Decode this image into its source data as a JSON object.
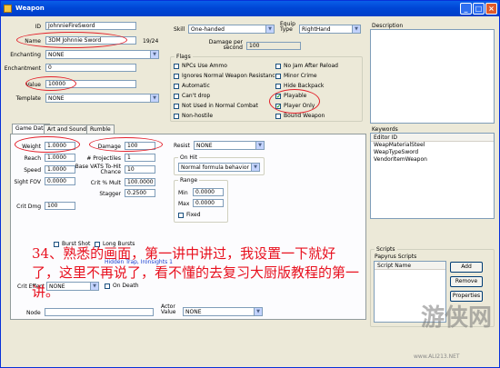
{
  "window": {
    "title": "Weapon",
    "min": "_",
    "max": "□",
    "close": "×"
  },
  "form": {
    "id_label": "ID",
    "id_value": "JohnnieFireSword",
    "name_label": "Name",
    "name_value": "3DM Johnnie Sword",
    "name_count": "19/24",
    "enchanting_label": "Enchanting",
    "enchanting_value": "NONE",
    "enchantment_label": "Enchantment",
    "enchantment_value": "0",
    "value_label": "Value",
    "value_value": "10000",
    "template_label": "Template",
    "template_value": "NONE",
    "skill_label": "Skill",
    "skill_value": "One-handed",
    "equip_label": "Equip Type",
    "equip_value": "RightHand",
    "damage_per_second_label": "Damage per second",
    "damage_per_second_value": "100"
  },
  "flags": {
    "title": "Flags",
    "items": [
      {
        "label": "NPCs Use Ammo",
        "checked": false
      },
      {
        "label": "Ignores Normal Weapon Resistance",
        "checked": false
      },
      {
        "label": "Automatic",
        "checked": false
      },
      {
        "label": "Can't drop",
        "checked": false
      },
      {
        "label": "Not Used in Normal Combat",
        "checked": false
      },
      {
        "label": "Non-hostile",
        "checked": false
      },
      {
        "label": "No Jam After Reload",
        "checked": false
      },
      {
        "label": "Minor Crime",
        "checked": false
      },
      {
        "label": "Hide Backpack",
        "checked": false
      },
      {
        "label": "Playable",
        "checked": true
      },
      {
        "label": "Player Only",
        "checked": true
      },
      {
        "label": "Bound Weapon",
        "checked": false
      }
    ]
  },
  "description_label": "Description",
  "tabs": [
    {
      "label": "Game Data",
      "active": true
    },
    {
      "label": "Art and Sound",
      "active": false
    },
    {
      "label": "Rumble",
      "active": false
    }
  ],
  "gamedata": {
    "weight_label": "Weight",
    "weight_value": "1.0000",
    "reach_label": "Reach",
    "reach_value": "1.0000",
    "speed_label": "Speed",
    "speed_value": "1.0000",
    "sight_label": "Sight FOV",
    "sight_value": "0.0000",
    "crit_label": "Crit Dmg",
    "crit_value": "100",
    "damage_label": "Damage",
    "damage_value": "100",
    "proj_label": "# Projectiles",
    "proj_value": "1",
    "vats_label": "Base VATS To-Hit Chance",
    "vats_value": "10",
    "critmult_label": "Crit % Mult",
    "critmult_value": "100.0000",
    "stagger_label": "Stagger",
    "stagger_value": "0.2500",
    "resist_label": "Resist",
    "resist_value": "NONE",
    "onhit_title": "On Hit",
    "onhit_value": "Normal formula behavior",
    "range_title": "Range",
    "min_label": "Min",
    "min_value": "0.0000",
    "max_label": "Max",
    "max_value": "0.0000",
    "fixed_label": "Fixed",
    "burst_label": "Burst Shot",
    "longburst_label": "Long Bursts",
    "crit_effect_label": "Crit Effect",
    "crit_effect_value": "NONE",
    "ondeath_label": "On Death",
    "node_label": "Node",
    "actor_label": "Actor Value",
    "actor_value": "NONE",
    "hidden_link": "Hidden Trap, Ironsights 1"
  },
  "keywords": {
    "title": "Keywords",
    "header": "Editor ID",
    "items": [
      "WeapMaterialSteel",
      "WeapTypeSword",
      "VendorItemWeapon"
    ]
  },
  "scripts": {
    "title": "Scripts",
    "sub": "Papyrus Scripts",
    "header": "Script Name",
    "add": "Add",
    "remove": "Remove",
    "properties": "Properties"
  },
  "overlay_text": "34、熟悉的画面，第一讲中讲过，我设置一下就好了，这里不再说了，看不懂的去复习大厨版教程的第一讲。",
  "watermark": {
    "text": "游侠网",
    "url": "www.ALI213.NET"
  }
}
